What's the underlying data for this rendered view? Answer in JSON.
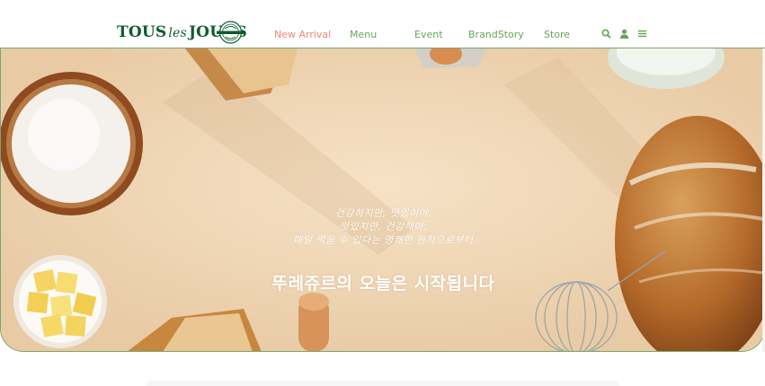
{
  "header": {
    "logo": {
      "main_left": "TOUS",
      "middle": "les",
      "main_right": "JOURS"
    },
    "nav": [
      {
        "label": "New Arrival",
        "active": true
      },
      {
        "label": "Menu",
        "active": false
      },
      {
        "label": "Event",
        "active": false
      },
      {
        "label": "BrandStory",
        "active": false
      },
      {
        "label": "Store",
        "active": false
      }
    ],
    "utility_icons": [
      "search-icon",
      "user-icon",
      "menu-icon"
    ]
  },
  "hero": {
    "copy_lines": [
      "건강하지만, 맛있어야,",
      "맛있지만, 건강해야,",
      "매일 먹을 수 있다는 명쾌한 원칙으로부터"
    ],
    "headline": "뚜레쥬르의 오늘은 시작됩니다"
  },
  "colors": {
    "brand_green": "#0f5b2f",
    "nav_green": "#6aa35a",
    "active_nav": "#ea8a72",
    "hero_bg": "#efd7b6",
    "border": "#7aa56c"
  }
}
